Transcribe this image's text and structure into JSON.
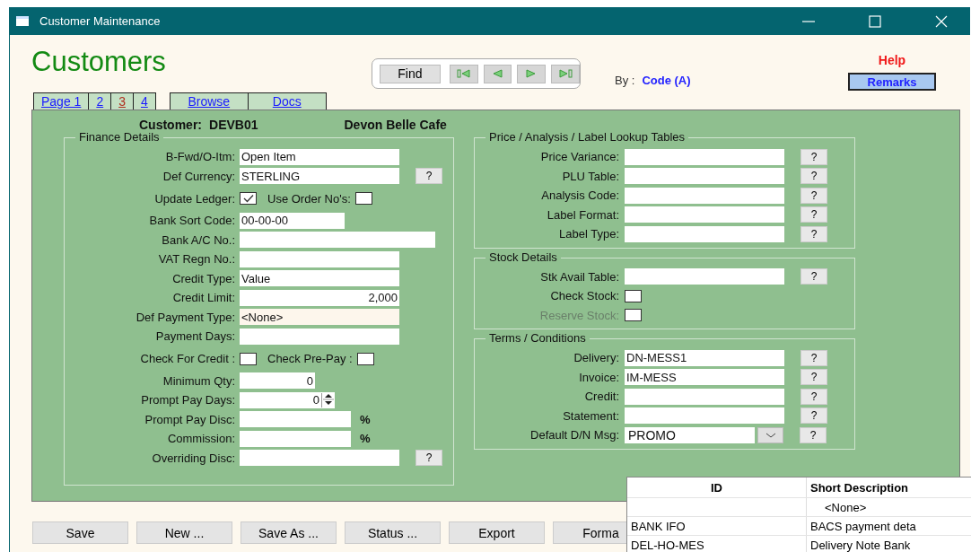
{
  "window": {
    "title": "Customer Maintenance"
  },
  "heading": "Customers",
  "navigator": {
    "find": "Find"
  },
  "sort": {
    "label": "By :",
    "value": "Code (A)"
  },
  "help": "Help",
  "remarks": "Remarks",
  "tabs": [
    {
      "label": "Page 1",
      "selected": false
    },
    {
      "label": "2",
      "selected": false
    },
    {
      "label": "3",
      "selected": true
    },
    {
      "label": "4",
      "selected": false
    }
  ],
  "links": [
    "Browse",
    "Docs"
  ],
  "customer": {
    "label": "Customer:",
    "code": "DEVB01",
    "name": "Devon Belle Cafe"
  },
  "finance": {
    "title": "Finance Details",
    "rows": [
      {
        "kind": "text",
        "label": "B-Fwd/O-Itm:",
        "value": "Open Item"
      },
      {
        "kind": "lookup",
        "label": "Def Currency:",
        "value": "STERLING",
        "button": "?"
      },
      {
        "kind": "checks",
        "items": [
          {
            "label": "Update Ledger:",
            "checked": true
          },
          {
            "label": "Use Order No's:",
            "checked": false
          }
        ]
      },
      {
        "kind": "short",
        "label": "Bank Sort Code:",
        "value": "00-00-00"
      },
      {
        "kind": "wide",
        "label": "Bank A/C No.:"
      },
      {
        "kind": "text",
        "label": "VAT Regn No.:"
      },
      {
        "kind": "text",
        "label": "Credit Type:",
        "value": "Value"
      },
      {
        "kind": "amount",
        "label": "Credit Limit:",
        "value": "2,000"
      },
      {
        "kind": "select",
        "label": "Def Payment Type:",
        "value": "<None>"
      },
      {
        "kind": "text",
        "label": "Payment Days:"
      },
      {
        "kind": "checks",
        "items": [
          {
            "label": "Check For Credit :",
            "checked": false
          },
          {
            "label": "Check Pre-Pay :",
            "checked": false
          }
        ]
      },
      {
        "kind": "number",
        "label": "Minimum Qty:",
        "value": "0"
      },
      {
        "kind": "spin",
        "label": "Prompt Pay Days:",
        "value": "0"
      },
      {
        "kind": "percent",
        "label": "Prompt Pay Disc:",
        "unit": "%"
      },
      {
        "kind": "percent",
        "label": "Commission:",
        "unit": "%"
      },
      {
        "kind": "lookup",
        "label": "Overriding Disc:",
        "button": "?"
      }
    ]
  },
  "groups": [
    {
      "title": "Price / Analysis / Label Lookup Tables",
      "rows": [
        {
          "kind": "lookup",
          "label": "Price Variance:",
          "button": "?"
        },
        {
          "kind": "lookup",
          "label": "PLU Table:",
          "button": "?"
        },
        {
          "kind": "lookup",
          "label": "Analysis Code:",
          "button": "?"
        },
        {
          "kind": "lookup",
          "label": "Label Format:",
          "button": "?"
        },
        {
          "kind": "lookup",
          "label": "Label Type:",
          "button": "?"
        }
      ]
    },
    {
      "title": "Stock Details",
      "rows": [
        {
          "kind": "lookup",
          "label": "Stk Avail Table:",
          "button": "?"
        },
        {
          "kind": "check",
          "label": "Check Stock:",
          "checked": false,
          "disabled": false
        },
        {
          "kind": "check",
          "label": "Reserve Stock:",
          "checked": false,
          "disabled": true
        }
      ]
    },
    {
      "title": "Terms  / Conditions",
      "rows": [
        {
          "kind": "lookup",
          "label": "Delivery:",
          "value": "DN-MESS1",
          "button": "?"
        },
        {
          "kind": "lookup",
          "label": "Invoice:",
          "value": "IM-MESS",
          "button": "?"
        },
        {
          "kind": "lookup",
          "label": "Credit:",
          "button": "?"
        },
        {
          "kind": "lookup",
          "label": "Statement:",
          "button": "?"
        },
        {
          "kind": "combo",
          "label": "Default D/N Msg:",
          "value": "PROMO",
          "button": "?"
        }
      ]
    }
  ],
  "buttons": [
    "Save",
    "New ...",
    "Save As ...",
    "Status ...",
    "Export",
    "Forma"
  ],
  "dropdown": {
    "columns": [
      "ID",
      "Short Description"
    ],
    "rows": [
      {
        "description": "<None>"
      },
      {
        "id": "BANK IFO",
        "description": "BACS payment deta"
      },
      {
        "id": "DEL-HO-MES",
        "description": "Delivery Note Bank"
      }
    ]
  }
}
